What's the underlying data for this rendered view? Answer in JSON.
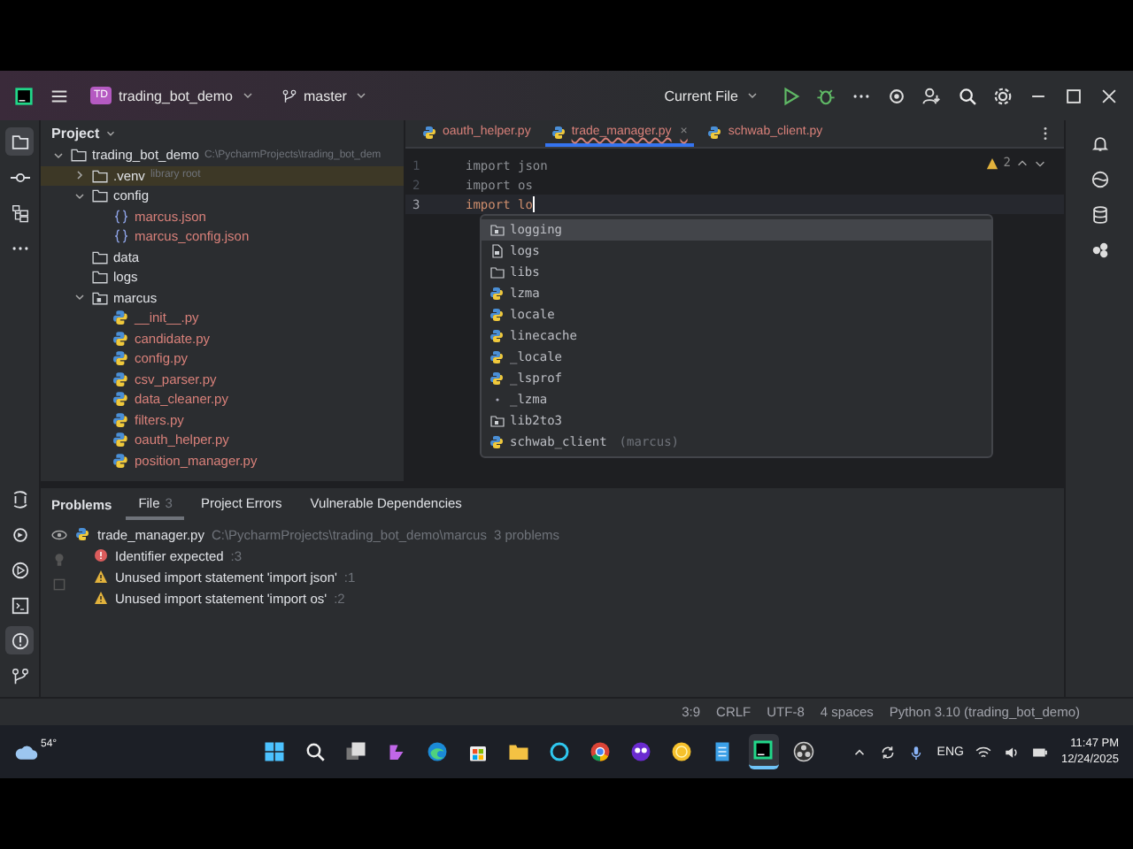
{
  "title_bar": {
    "project_badge": "TD",
    "project": "trading_bot_demo",
    "branch": "master",
    "run_config": "Current File"
  },
  "left_toolbar": {
    "top": [
      {
        "kind": "project",
        "selected": true
      },
      {
        "kind": "commit",
        "selected": false
      },
      {
        "kind": "structure",
        "selected": false
      },
      {
        "kind": "more",
        "selected": false
      }
    ],
    "bottom": [
      {
        "kind": "console",
        "selected": false
      },
      {
        "kind": "services",
        "selected": false
      },
      {
        "kind": "run",
        "selected": false
      },
      {
        "kind": "terminal",
        "selected": false
      },
      {
        "kind": "problems",
        "selected": true
      },
      {
        "kind": "git",
        "selected": false
      }
    ]
  },
  "project_panel": {
    "title": "Project",
    "tree": [
      {
        "name": "trading_bot_demo",
        "hint": "C:\\PycharmProjects\\trading_bot_dem",
        "kind": "folder",
        "expanded": true,
        "children": [
          {
            "name": ".venv",
            "hint": "library root",
            "kind": "library",
            "expanded": false
          },
          {
            "name": "config",
            "kind": "folder",
            "expanded": true,
            "children": [
              {
                "name": "marcus.json",
                "kind": "json"
              },
              {
                "name": "marcus_config.json",
                "kind": "json"
              }
            ]
          },
          {
            "name": "data",
            "kind": "folder"
          },
          {
            "name": "logs",
            "kind": "folder"
          },
          {
            "name": "marcus",
            "kind": "package",
            "expanded": true,
            "children": [
              {
                "name": "__init__.py",
                "kind": "python"
              },
              {
                "name": "candidate.py",
                "kind": "python"
              },
              {
                "name": "config.py",
                "kind": "python"
              },
              {
                "name": "csv_parser.py",
                "kind": "python"
              },
              {
                "name": "data_cleaner.py",
                "kind": "python"
              },
              {
                "name": "filters.py",
                "kind": "python"
              },
              {
                "name": "oauth_helper.py",
                "kind": "python"
              },
              {
                "name": "position_manager.py",
                "kind": "python"
              }
            ]
          }
        ]
      }
    ]
  },
  "editor": {
    "tabs": [
      {
        "label": "oauth_helper.py",
        "selected": false
      },
      {
        "label": "trade_manager.py",
        "selected": true,
        "close": "×"
      },
      {
        "label": "schwab_client.py",
        "selected": false
      }
    ],
    "warnings": "2",
    "lines": [
      {
        "number": "1",
        "code": "import json",
        "current": false
      },
      {
        "number": "2",
        "code": "import os",
        "current": false
      },
      {
        "number": "3",
        "code": "import lo",
        "current": true
      }
    ],
    "completion": [
      {
        "text": "logging",
        "kind": "package",
        "selected": true
      },
      {
        "text": "logs",
        "kind": "file",
        "selected": false
      },
      {
        "text": "libs",
        "kind": "folder",
        "selected": false
      },
      {
        "text": "lzma",
        "kind": "python",
        "selected": false
      },
      {
        "text": "locale",
        "kind": "python",
        "selected": false
      },
      {
        "text": "linecache",
        "kind": "python",
        "selected": false
      },
      {
        "text": "_locale",
        "kind": "python",
        "selected": false
      },
      {
        "text": "_lsprof",
        "kind": "python",
        "selected": false
      },
      {
        "text": "_lzma",
        "kind": "dot",
        "selected": false
      },
      {
        "text": "lib2to3",
        "kind": "package",
        "selected": false
      },
      {
        "text": "schwab_client",
        "hint": "(marcus)",
        "kind": "python",
        "selected": false
      }
    ]
  },
  "problems": {
    "title": "Problems",
    "tabs": [
      {
        "label": "File",
        "count": "3",
        "selected": true
      },
      {
        "label": "Project Errors",
        "selected": false
      },
      {
        "label": "Vulnerable Dependencies",
        "selected": false
      }
    ],
    "file": {
      "name": "trade_manager.py",
      "path": "C:\\PycharmProjects\\trading_bot_demo\\marcus",
      "count": "3 problems"
    },
    "items": [
      {
        "kind": "error",
        "text": "Identifier expected",
        "location": ":3"
      },
      {
        "kind": "warning",
        "text": "Unused import statement 'import json'",
        "location": ":1"
      },
      {
        "kind": "warning",
        "text": "Unused import statement 'import os'",
        "location": ":2"
      }
    ]
  },
  "status_bar": [
    "3:9",
    "CRLF",
    "UTF-8",
    "4 spaces",
    "Python 3.10 (trading_bot_demo)"
  ],
  "taskbar": {
    "temperature": "54°",
    "apps": [
      {
        "kind": "windows",
        "selected": false
      },
      {
        "kind": "search",
        "selected": false
      },
      {
        "kind": "taskview",
        "selected": false
      },
      {
        "kind": "copilot",
        "selected": false
      },
      {
        "kind": "edge",
        "selected": false
      },
      {
        "kind": "store",
        "selected": false
      },
      {
        "kind": "explorer",
        "selected": false
      },
      {
        "kind": "alexa",
        "selected": false
      },
      {
        "kind": "chrome",
        "selected": false
      },
      {
        "kind": "owl",
        "selected": false
      },
      {
        "kind": "circle",
        "selected": false
      },
      {
        "kind": "notepad",
        "selected": false
      },
      {
        "kind": "pycharm",
        "selected": true
      },
      {
        "kind": "obs",
        "selected": false
      }
    ],
    "language": "ENG",
    "time": "11:47 PM",
    "date": "12/24/2025"
  }
}
